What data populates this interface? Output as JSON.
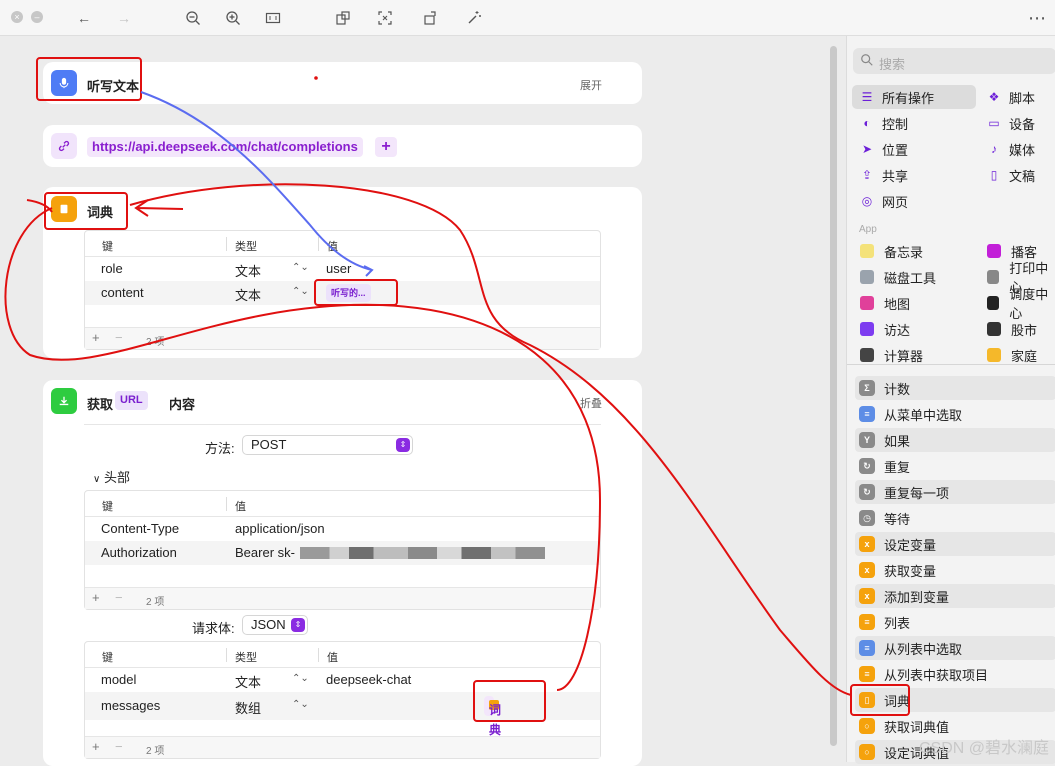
{
  "toolbar": {
    "close_glyph": "×",
    "min_glyph": "–",
    "back_glyph": "←",
    "forward_glyph": "→",
    "more_glyph": "⋯"
  },
  "editor": {
    "dictation": {
      "title": "听写文本",
      "expand_label": "展开",
      "icon": "microphone-icon"
    },
    "url_action": {
      "url": "https://api.deepseek.com/chat/completions",
      "add_label": "+",
      "icon": "link-icon"
    },
    "dictionary": {
      "title": "词典",
      "icon": "dictionary-icon",
      "headers": {
        "key": "键",
        "type": "类型",
        "value": "值"
      },
      "rows": [
        {
          "key": "role",
          "type": "文本",
          "value": "user"
        },
        {
          "key": "content",
          "type": "文本",
          "value": "听写的..."
        }
      ],
      "count": "2 项",
      "stepper_glyph": "⌃⌄"
    },
    "fetch": {
      "title_prefix": "获取",
      "url_token": "URL",
      "title_suffix": "内容",
      "collapse_label": "折叠",
      "method_label": "方法:",
      "method_value": "POST",
      "headers_label": "头部",
      "headers_table": {
        "headers": {
          "key": "键",
          "value": "值"
        },
        "rows": [
          {
            "key": "Content-Type",
            "value": "application/json"
          },
          {
            "key": "Authorization",
            "value": "Bearer sk-"
          }
        ],
        "count": "2 项"
      },
      "body_label": "请求体:",
      "body_value": "JSON",
      "body_table": {
        "headers": {
          "key": "键",
          "type": "类型",
          "value": "值"
        },
        "rows": [
          {
            "key": "model",
            "type": "文本",
            "value": "deepseek-chat"
          },
          {
            "key": "messages",
            "type": "数组",
            "value": "词典"
          }
        ],
        "count": "2 项"
      }
    }
  },
  "sidebar": {
    "search_placeholder": "搜索",
    "categories_left": [
      "所有操作",
      "控制",
      "位置",
      "共享",
      "网页"
    ],
    "categories_right": [
      "脚本",
      "设备",
      "媒体",
      "文稿"
    ],
    "app_label": "App",
    "apps_left": [
      "备忘录",
      "磁盘工具",
      "地图",
      "访达",
      "计算器"
    ],
    "apps_right": [
      "播客",
      "打印中心",
      "调度中心",
      "股市",
      "家庭"
    ],
    "actions": [
      "计数",
      "从菜单中选取",
      "如果",
      "重复",
      "重复每一项",
      "等待",
      "设定变量",
      "获取变量",
      "添加到变量",
      "列表",
      "从列表中选取",
      "从列表中获取项目",
      "词典",
      "获取词典值",
      "设定词典值"
    ]
  },
  "watermark": "CSDN @碧水澜庭",
  "colors": {
    "accent": "#8a1fcf",
    "annotation_red": "#e01010",
    "annotation_blue": "#5b6cf0"
  }
}
